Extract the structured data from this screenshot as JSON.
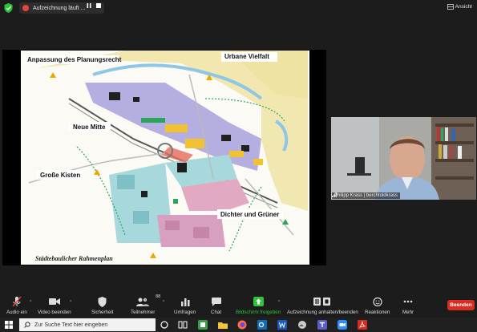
{
  "topbar": {
    "recording_label": "Aufzeichnung läuft ...",
    "view_label": "Ansicht"
  },
  "slide": {
    "title_top_left": "Anpassung des Planungsrecht",
    "title_top_right": "Urbane Vielfalt",
    "title_mid_left": "Neue Mitte",
    "title_bottom_left": "Große Kisten",
    "title_bottom_right": "Dichter und Grüner",
    "caption": "Städtebaulicher Rahmenplan"
  },
  "video": {
    "participant_name": "Philipp Krass | berchtoldkrass"
  },
  "toolbar": {
    "audio": "Audio ein",
    "video": "Video beenden",
    "security": "Sicherheit",
    "participants": "Teilnehmer",
    "participants_count": "88",
    "polls": "Umfragen",
    "chat": "Chat",
    "share": "Bildschirm freigeben",
    "recording": "Aufzeichnung anhalten/beenden",
    "reactions": "Reaktionen",
    "more": "Mehr",
    "end": "Beenden"
  },
  "taskbar": {
    "search_placeholder": "Zur Suche Text hier eingeben"
  },
  "colors": {
    "accent_green": "#2dc33a",
    "end_red": "#d92d20",
    "record_red": "#e8453c"
  }
}
